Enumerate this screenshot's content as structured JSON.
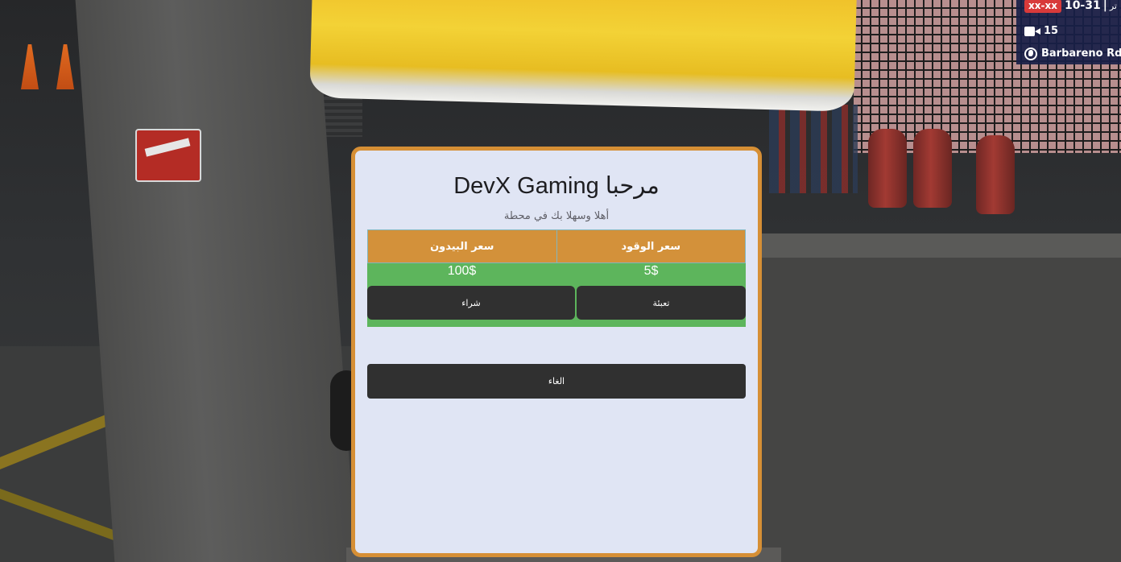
{
  "hud": {
    "code_badge": "xx-xx",
    "date": "10-31",
    "separator": "|",
    "tail_text": "تر",
    "count": "15",
    "location": "Barbareno Rd",
    "icons": {
      "camera": "video-camera-icon",
      "location": "globe-icon"
    }
  },
  "dialog": {
    "title": "مرحبا DevX Gaming",
    "subtitle": "أهلا وسهلا بك في محطة",
    "table": {
      "headers": {
        "fuel": "سعر الوقود",
        "can": "سعر البيدون"
      },
      "prices": {
        "fuel": "5$",
        "can": "100$"
      }
    },
    "buttons": {
      "refuel": "تعبئة",
      "buy": "شراء",
      "cancel": "الغاء"
    }
  },
  "colors": {
    "panel_bg": "#e0e5f4",
    "panel_border": "#d68f35",
    "header_bg": "#d3913a",
    "price_bg": "#5db55c",
    "button_bg": "#303030",
    "hud_badge": "#d83a3a"
  }
}
